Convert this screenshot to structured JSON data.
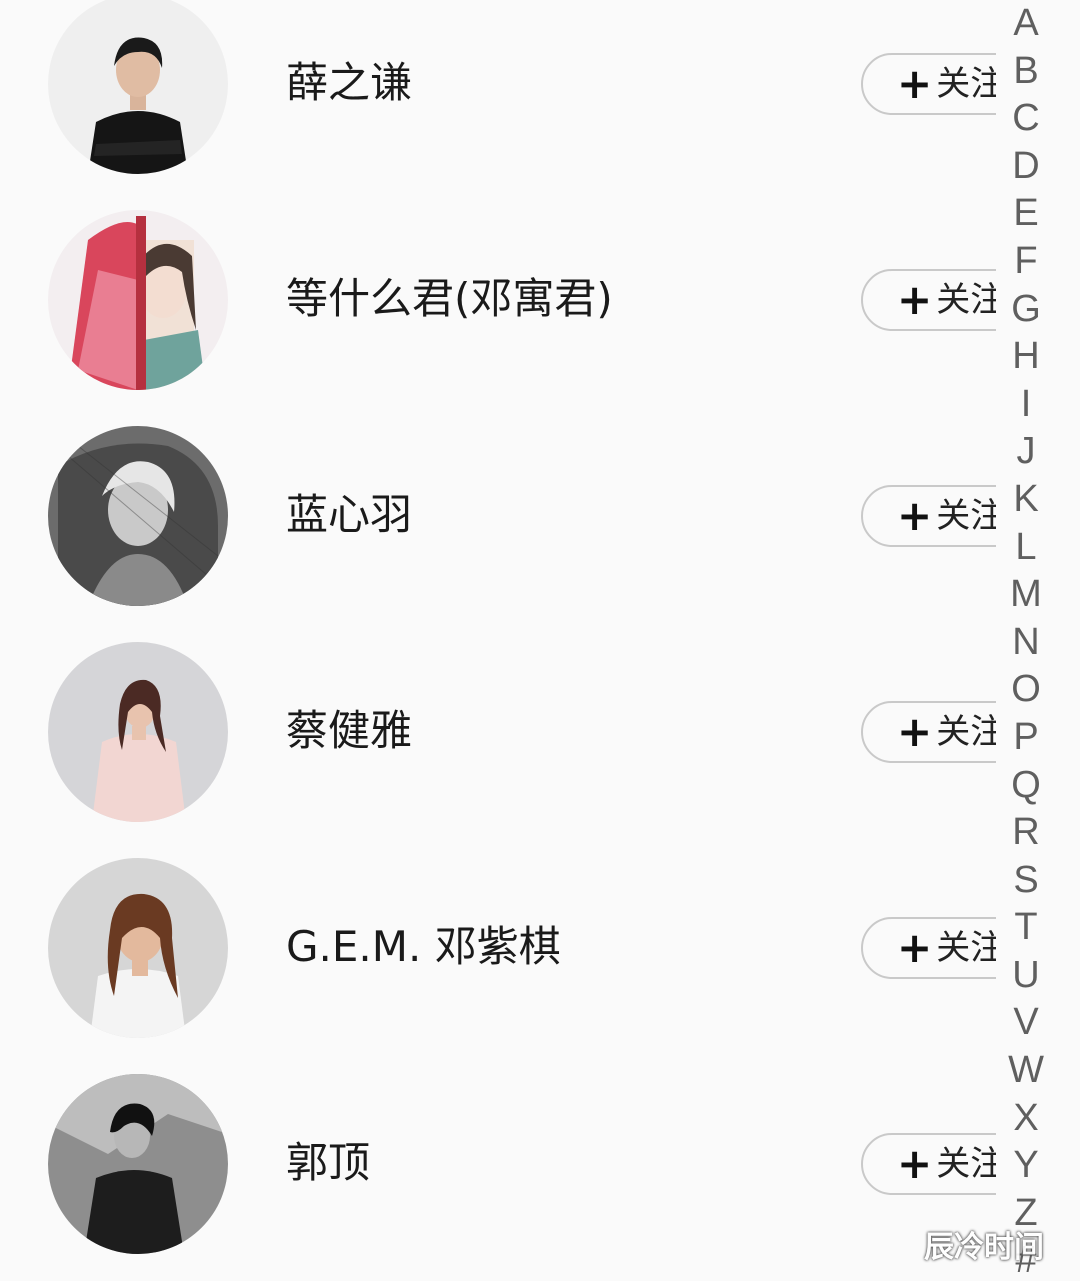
{
  "follow_label": "关注",
  "plus_glyph": "+",
  "artists": [
    {
      "name": "薛之谦",
      "avatar": "man-black-suit-photo"
    },
    {
      "name": "等什么君(邓寓君)",
      "avatar": "illustrated-bride-red-veil"
    },
    {
      "name": "蓝心羽",
      "avatar": "woman-bw-veil-photo"
    },
    {
      "name": "蔡健雅",
      "avatar": "woman-pink-blazer-photo"
    },
    {
      "name": "G.E.M. 邓紫棋",
      "avatar": "woman-white-top-photo"
    },
    {
      "name": "郭顶",
      "avatar": "man-bw-dark-photo"
    }
  ],
  "index_letters": [
    "A",
    "B",
    "C",
    "D",
    "E",
    "F",
    "G",
    "H",
    "I",
    "J",
    "K",
    "L",
    "M",
    "N",
    "O",
    "P",
    "Q",
    "R",
    "S",
    "T",
    "U",
    "V",
    "W",
    "X",
    "Y",
    "Z",
    "#"
  ],
  "watermark": "辰冷时间"
}
